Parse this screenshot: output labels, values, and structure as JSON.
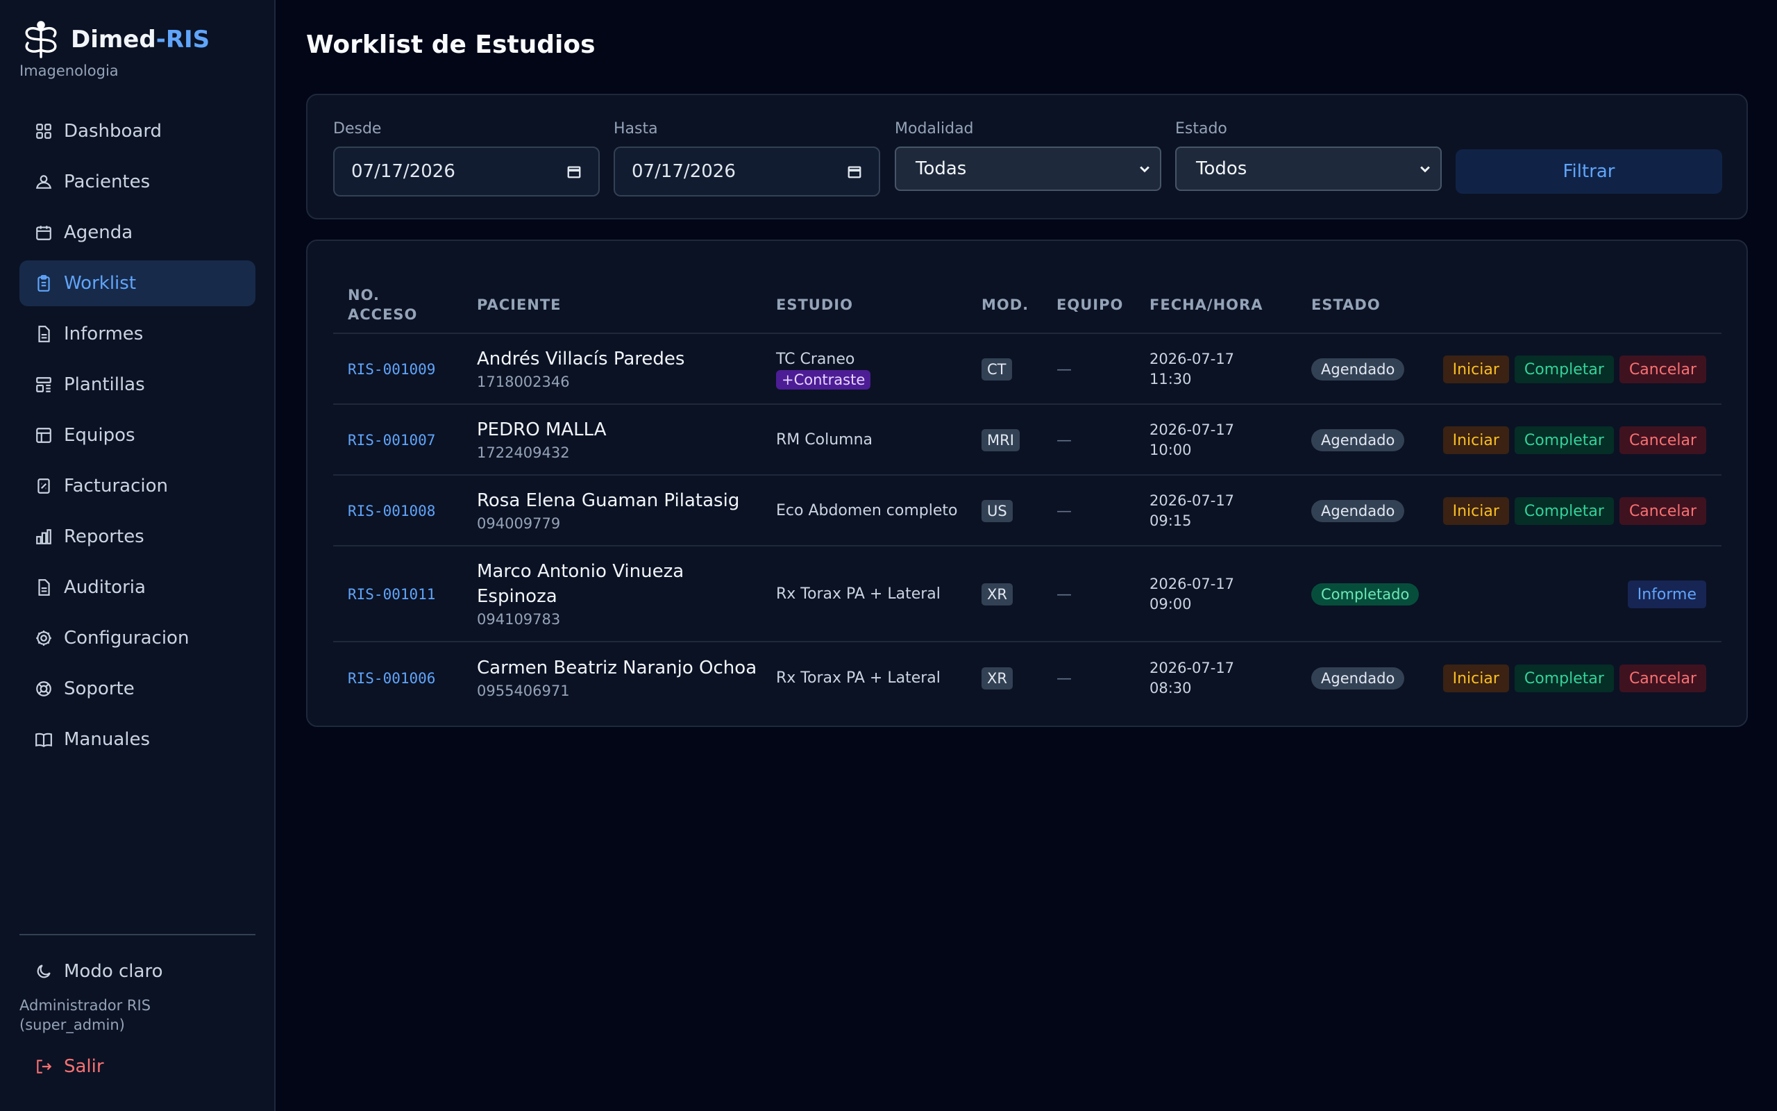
{
  "app": {
    "brand_main": "Dimed",
    "brand_accent": "-RIS",
    "subtitle": "Imagenologia"
  },
  "sidebar": {
    "items": [
      {
        "label": "Dashboard",
        "icon": "grid-icon"
      },
      {
        "label": "Pacientes",
        "icon": "user-icon"
      },
      {
        "label": "Agenda",
        "icon": "calendar-icon"
      },
      {
        "label": "Worklist",
        "icon": "clipboard-icon",
        "active": true
      },
      {
        "label": "Informes",
        "icon": "document-icon"
      },
      {
        "label": "Plantillas",
        "icon": "template-icon"
      },
      {
        "label": "Equipos",
        "icon": "table-icon"
      },
      {
        "label": "Facturacion",
        "icon": "receipt-icon"
      },
      {
        "label": "Reportes",
        "icon": "bar-chart-icon"
      },
      {
        "label": "Auditoria",
        "icon": "document-icon"
      },
      {
        "label": "Configuracion",
        "icon": "gear-icon"
      },
      {
        "label": "Soporte",
        "icon": "lifebuoy-icon"
      },
      {
        "label": "Manuales",
        "icon": "book-icon"
      }
    ],
    "theme_toggle": "Modo claro",
    "user": "Administrador RIS (super_admin)",
    "logout": "Salir"
  },
  "page": {
    "title": "Worklist de Estudios"
  },
  "filters": {
    "from_label": "Desde",
    "from_value": "07/17/2026",
    "to_label": "Hasta",
    "to_value": "07/17/2026",
    "modality_label": "Modalidad",
    "modality_value": "Todas",
    "status_label": "Estado",
    "status_value": "Todos",
    "filter_button": "Filtrar"
  },
  "table": {
    "headers": {
      "accession_line1": "NO.",
      "accession_line2": "ACCESO",
      "patient": "PACIENTE",
      "study": "ESTUDIO",
      "modality": "MOD.",
      "equipment": "EQUIPO",
      "datetime": "FECHA/HORA",
      "status": "ESTADO"
    },
    "rows": [
      {
        "accession": "RIS-001009",
        "name": "Andrés Villacís Paredes",
        "patient_id": "1718002346",
        "study": "TC Craneo",
        "contrast": "+Contraste",
        "modality": "CT",
        "equipment": "—",
        "date": "2026-07-17",
        "time": "11:30",
        "status": "Agendado"
      },
      {
        "accession": "RIS-001007",
        "name": "PEDRO MALLA",
        "patient_id": "1722409432",
        "study": "RM Columna",
        "contrast": "",
        "modality": "MRI",
        "equipment": "—",
        "date": "2026-07-17",
        "time": "10:00",
        "status": "Agendado"
      },
      {
        "accession": "RIS-001008",
        "name": "Rosa Elena Guaman Pilatasig",
        "patient_id": "094009779",
        "study": "Eco Abdomen completo",
        "contrast": "",
        "modality": "US",
        "equipment": "—",
        "date": "2026-07-17",
        "time": "09:15",
        "status": "Agendado"
      },
      {
        "accession": "RIS-001011",
        "name_line1": "Marco Antonio Vinueza",
        "name_line2": "Espinoza",
        "patient_id": "094109783",
        "study": "Rx Torax PA + Lateral",
        "contrast": "",
        "modality": "XR",
        "equipment": "—",
        "date": "2026-07-17",
        "time": "09:00",
        "status": "Completado"
      },
      {
        "accession": "RIS-001006",
        "name": "Carmen Beatriz Naranjo Ochoa",
        "patient_id": "0955406971",
        "study": "Rx Torax PA + Lateral",
        "contrast": "",
        "modality": "XR",
        "equipment": "—",
        "date": "2026-07-17",
        "time": "08:30",
        "status": "Agendado"
      }
    ],
    "actions": {
      "start": "Iniciar",
      "complete": "Completar",
      "cancel": "Cancelar",
      "report": "Informe"
    }
  }
}
